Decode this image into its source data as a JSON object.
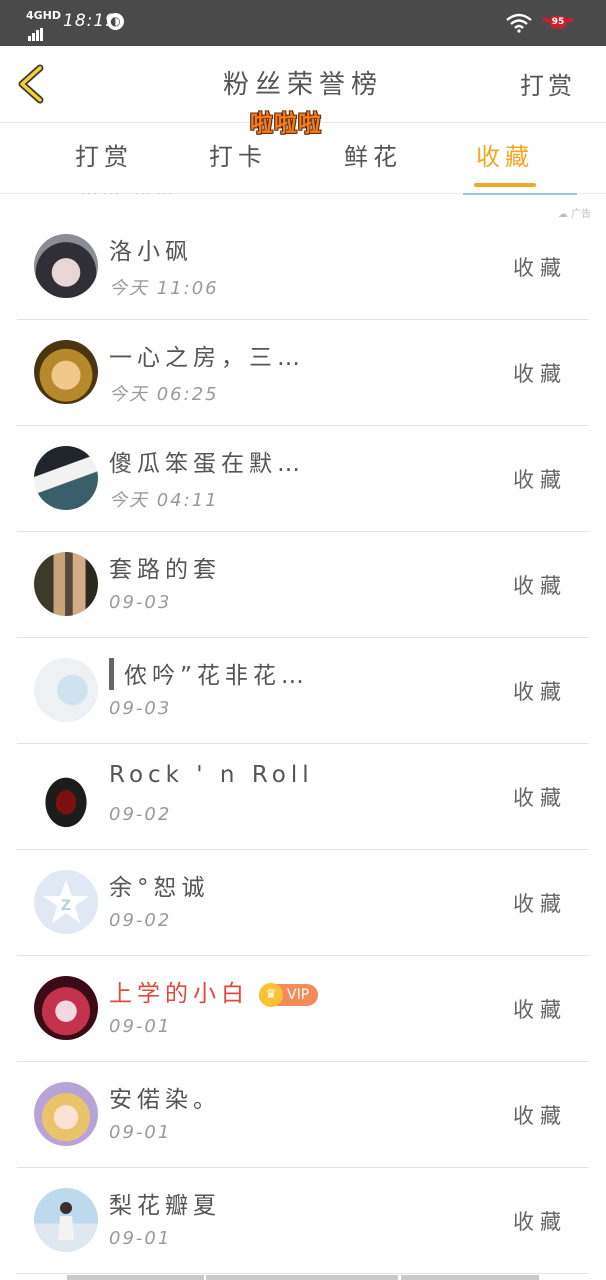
{
  "status_bar": {
    "network": "4GHD",
    "time": "18:19",
    "battery": "95",
    "colors": {
      "background": "#4a4a4a",
      "battery": "#c9202b"
    }
  },
  "header": {
    "title": "粉丝荣誉榜",
    "action": "打赏",
    "sticker": "啦啦啦"
  },
  "tabs": [
    {
      "label": "打赏",
      "active": false
    },
    {
      "label": "打卡",
      "active": false
    },
    {
      "label": "鲜花",
      "active": false
    },
    {
      "label": "收藏",
      "active": true
    }
  ],
  "ad_label": "广告",
  "cut_off_text": "…… ……",
  "accent_color": "#f5a623",
  "rows": [
    {
      "name": "洛小砜",
      "date": "今天 11:06",
      "action": "收藏",
      "avatar": "anime-girl-avatar"
    },
    {
      "name": "一心之房，三…",
      "date": "今天 06:25",
      "action": "收藏",
      "avatar": "doll-avatar"
    },
    {
      "name": "傻瓜笨蛋在默…",
      "date": "今天 04:11",
      "action": "收藏",
      "avatar": "anime-boy-avatar"
    },
    {
      "name": "套路的套",
      "date": "09-03",
      "action": "收藏",
      "avatar": "movie-couple-avatar"
    },
    {
      "name": "侬吟”花非花…",
      "date": "09-03",
      "action": "收藏",
      "avatar": "anime-blur-avatar",
      "quote_bar": true
    },
    {
      "name": "Rock ' n Roll",
      "date": "09-02",
      "action": "收藏",
      "avatar": "dark-character-avatar"
    },
    {
      "name": "余°恕诚",
      "date": "09-02",
      "action": "收藏",
      "avatar": "qq-default-avatar"
    },
    {
      "name": "上学的小白",
      "date": "09-01",
      "action": "收藏",
      "avatar": "red-anime-avatar",
      "vip": "VIP",
      "highlight": true
    },
    {
      "name": "安偌染。",
      "date": "09-01",
      "action": "收藏",
      "avatar": "blonde-anime-avatar"
    },
    {
      "name": "梨花瓣夏",
      "date": "09-01",
      "action": "收藏",
      "avatar": "girl-photo-avatar"
    }
  ]
}
